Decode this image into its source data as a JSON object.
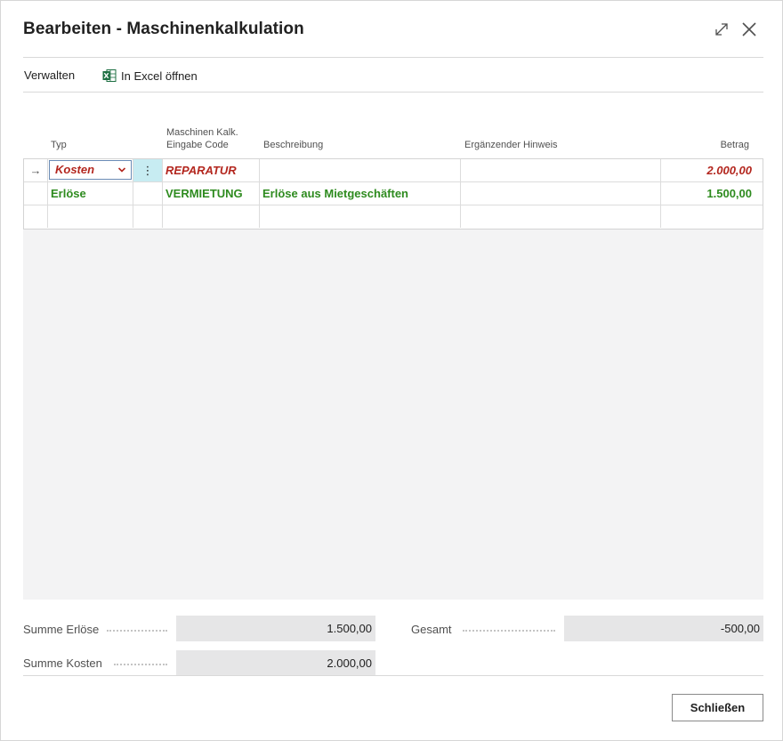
{
  "dialog": {
    "title": "Bearbeiten - Maschinenkalkulation"
  },
  "actions": {
    "manage": "Verwalten",
    "excel": "In Excel öffnen"
  },
  "grid": {
    "headers": {
      "typ": "Typ",
      "code_line1": "Maschinen Kalk.",
      "code_line2": "Eingabe Code",
      "beschreibung": "Beschreibung",
      "hinweis": "Ergänzender Hinweis",
      "betrag": "Betrag"
    },
    "rows": [
      {
        "indicator": "→",
        "typ": "Kosten",
        "code": "REPARATUR",
        "beschreibung": "",
        "hinweis": "",
        "betrag": "2.000,00"
      },
      {
        "indicator": "",
        "typ": "Erlöse",
        "code": "VERMIETUNG",
        "beschreibung": "Erlöse aus Mietgeschäften",
        "hinweis": "",
        "betrag": "1.500,00"
      },
      {
        "indicator": "",
        "typ": "",
        "code": "",
        "beschreibung": "",
        "hinweis": "",
        "betrag": ""
      }
    ],
    "menu_glyph": "⋮",
    "chevron": "⌄"
  },
  "totals": {
    "summe_erloese_label": "Summe Erlöse",
    "summe_erloese_value": "1.500,00",
    "summe_kosten_label": "Summe Kosten",
    "summe_kosten_value": "2.000,00",
    "gesamt_label": "Gesamt",
    "gesamt_value": "-500,00"
  },
  "footer": {
    "close_label": "Schließen"
  },
  "colors": {
    "cost_red": "#b3261e",
    "revenue_green": "#2e8b1f",
    "excel_green": "#1d6f42"
  }
}
